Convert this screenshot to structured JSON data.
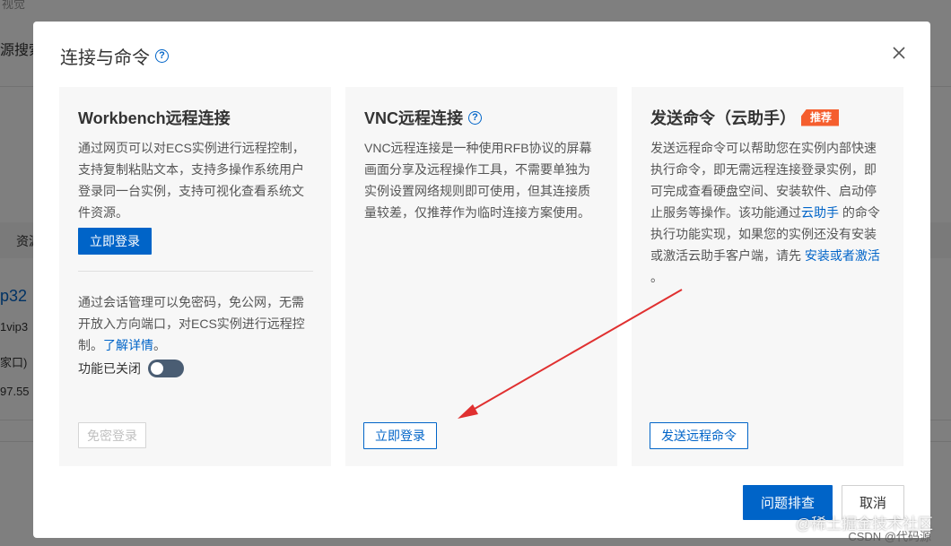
{
  "background": {
    "top_text": "视觉",
    "search_text": "源搜索",
    "col_label": "资源",
    "ip_text": "p32",
    "sub_text": "1vip3",
    "store_text": "家口)",
    "num_text": "97.55"
  },
  "dialog": {
    "title": "连接与命令",
    "close_label": "×"
  },
  "cards": {
    "workbench": {
      "title": "Workbench远程连接",
      "desc": "通过网页可以对ECS实例进行远程控制，支持复制粘贴文本，支持多操作系统用户登录同一台实例，支持可视化查看系统文件资源。",
      "login_button": "立即登录",
      "session_desc": "通过会话管理可以免密码，免公网，无需开放入方向端口，对ECS实例进行远程控制。",
      "learn_more": "了解详情",
      "learn_more_suffix": "。",
      "toggle_label": "功能已关闭",
      "passwordless_button": "免密登录"
    },
    "vnc": {
      "title": "VNC远程连接",
      "desc": "VNC远程连接是一种使用RFB协议的屏幕画面分享及远程操作工具，不需要单独为实例设置网络规则即可使用，但其连接质量较差，仅推荐作为临时连接方案使用。",
      "login_button": "立即登录"
    },
    "command": {
      "title": "发送命令（云助手）",
      "badge": "推荐",
      "desc_part1": "发送远程命令可以帮助您在实例内部快速执行命令，即无需远程连接登录实例，即可完成查看硬盘空间、安装软件、启动停止服务等操作。该功能通过",
      "link1": "云助手",
      "desc_part2": " 的命令执行功能实现，如果您的实例还没有安装或激活云助手客户端，请先 ",
      "link2": "安装或者激活",
      "desc_part3": " 。",
      "send_button": "发送远程命令"
    }
  },
  "footer": {
    "troubleshoot_button": "问题排查",
    "cancel_button": "取消"
  },
  "watermarks": {
    "juejin": "@稀土掘金技术社区",
    "csdn": "CSDN @代码源"
  },
  "colors": {
    "accent": "#0064c8",
    "badge": "#f55e2e",
    "arrow": "#e03030"
  }
}
